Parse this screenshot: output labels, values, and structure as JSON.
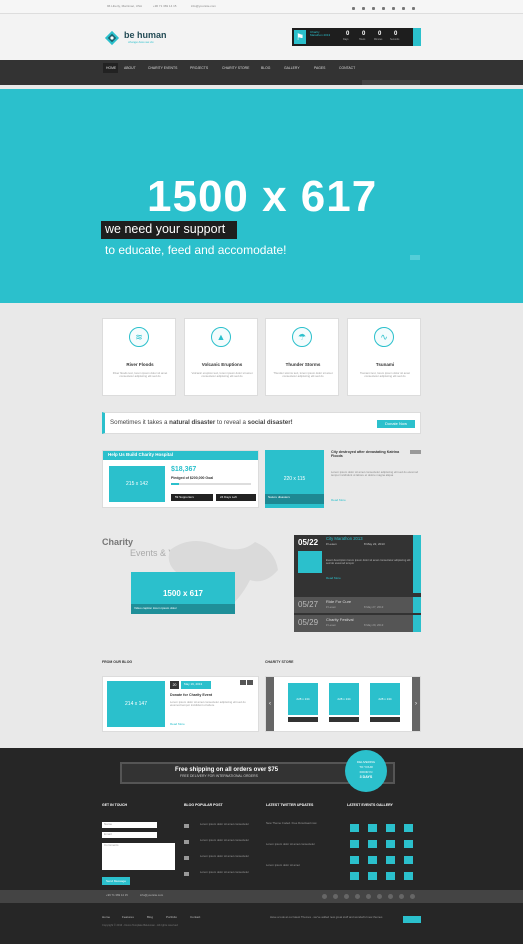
{
  "topbar": {
    "address": "96 Liberty, Marrimac, USA",
    "phone": "+96 71 369 14 15",
    "email": "info@yoursite.com"
  },
  "header": {
    "logo_title": "be human",
    "logo_tagline": "change lives we do",
    "countdown_title": "Charity\nMarathon 2013",
    "countdown": [
      {
        "value": "0",
        "unit": "Days"
      },
      {
        "value": "0",
        "unit": "Hours"
      },
      {
        "value": "0",
        "unit": "Minutes"
      },
      {
        "value": "0",
        "unit": "Seconds"
      }
    ]
  },
  "nav": [
    "HOME",
    "ABOUT",
    "CHARITY EVENTS",
    "PROJECTS",
    "CHARITY STORE",
    "BLOG",
    "GALLERY",
    "PAGES",
    "CONTACT"
  ],
  "hero": {
    "size": "1500 x 617",
    "tagline": "we need your support",
    "subline": "to educate, feed and accomodate!"
  },
  "features": [
    {
      "icon": "flood-icon",
      "glyph": "≋",
      "title": "River Floods",
      "text": "River floods text, lorem ipsum dolor sit amet consectetur adipiscing elit sed do"
    },
    {
      "icon": "volcano-icon",
      "glyph": "▲",
      "title": "Volcanic Eruptions",
      "text": "Volcanic eruption text, lorem ipsum dolor sit amet consectetur adipiscing elit sed do"
    },
    {
      "icon": "storm-icon",
      "glyph": "☂",
      "title": "Thunder Storms",
      "text": "Thunder storms text, lorem ipsum dolor sit amet consectetur adipiscing elit sed do"
    },
    {
      "icon": "tsunami-icon",
      "glyph": "∿",
      "title": "Tsunami",
      "text": "Tsunami text, lorem ipsum dolor sit amet consectetur adipiscing elit sed do"
    }
  ],
  "callout": {
    "pre": "Sometimes it takes a",
    "b1": "natural disaster",
    "mid": "to reveal a",
    "b2": "social disaster!",
    "button": "Donate Now"
  },
  "project": {
    "title": "Help Us Build Charity Hospital",
    "image_size": "215 x 142",
    "amount": "$18,367",
    "pledged": "Pledged of $200,000 Goal",
    "supporters": "59 Supporters",
    "days_left": "24 Days Left"
  },
  "event_feature": {
    "image_size": "220 x 115",
    "caption": "Nature disasters",
    "title": "City destroyed after devastating Katrina Floods",
    "read_more": "Read More",
    "text": "Lorem ipsum dolor sit amet consectetur adipiscing elit sed do eiusmod tempor incididunt ut labore et dolore magna aliqua"
  },
  "charity": {
    "title": "Charity",
    "subtitle": "Events & Videos",
    "video_size": "1500 x 617",
    "video_caption": "Video caption lorem ipsum dolor"
  },
  "events": [
    {
      "date": "05/22",
      "title": "City Marathon 2013",
      "place": "# Lesen",
      "when": "8 May 22, 2013",
      "text": "Event description lorem ipsum dolor sit amet consectetur adipiscing elit sed do eiusmod tempor",
      "read_more": "Read More"
    },
    {
      "date": "05/27",
      "title": "Ride For Cure",
      "place": "# Lesen",
      "when": "8 May 27, 2013"
    },
    {
      "date": "05/29",
      "title": "Charity Festival",
      "place": "# Lesen",
      "when": "8 May 29, 2013"
    }
  ],
  "blog": {
    "heading": "FROM OUR BLOG",
    "image_size": "214 x 147",
    "date_day": "20",
    "date_label": "May 19, 2013",
    "title": "Donate for Charity Event",
    "text": "Lorem ipsum dolor sit amet consectetur adipiscing elit sed do eiusmod tempor incididunt ut labore",
    "read_more": "Read More"
  },
  "store": {
    "heading": "CHARITY STORE",
    "items": [
      "228 x 134",
      "228 x 134",
      "228 x 134"
    ]
  },
  "shipping": {
    "line1": "Free shipping on all orders over $75",
    "line2": "FREE DELIVERY FOR INTERNATIONAL ORDERS",
    "badge1": "DELIVERING",
    "badge2": "TO YOUR",
    "badge3": "DOOR IN",
    "badge4": "3 DAYS"
  },
  "footer": {
    "col1": "GET IN TOUCH",
    "col2": "BLOG POPULAR POST",
    "col3": "LATEST TWITTER UPDATES",
    "col4": "LATEST EVENTS GALLERY",
    "form_name": "Name",
    "form_email": "Email",
    "form_comments": "Comments",
    "form_button": "Send Message",
    "posts": [
      "Lorem ipsum dolor sit amet consectetur",
      "Lorem ipsum dolor sit amet consectetur",
      "Lorem ipsum dolor sit amet consectetur",
      "Lorem ipsum dolor sit amet consectetur"
    ],
    "tweets": [
      "New Theme Coded. Free Download now",
      "Lorem ipsum dolor sit amet consectetur",
      "Lorem ipsum dolor sit amet"
    ],
    "contact_phone": "+96 71 369 14 15",
    "contact_email": "info@yoursite.com",
    "links": [
      "Home",
      "Features",
      "Blog",
      "Portfolio",
      "Contact"
    ],
    "copyright": "Copyright © 2013 - Demo Template BeHuman - All rights reserved",
    "newsletter": "Have a look at our latest Themes - we've added new great stuff and wonderful new themes"
  }
}
